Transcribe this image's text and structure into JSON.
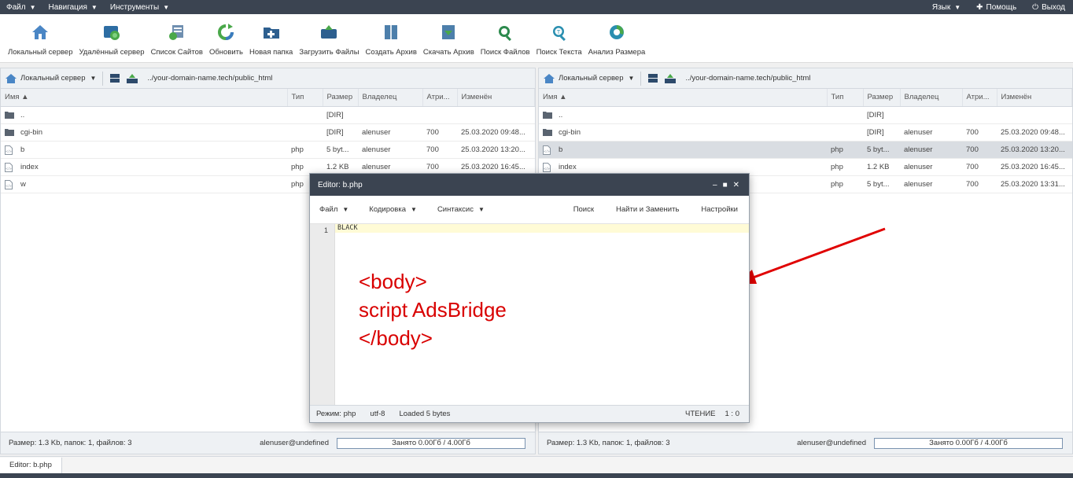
{
  "menu": {
    "file": "Файл",
    "navigation": "Навигация",
    "tools": "Инструменты",
    "language": "Язык",
    "help": "Помощь",
    "logout": "Выход"
  },
  "toolbar": [
    {
      "label": "Локальный сервер",
      "icon": "local-server-icon"
    },
    {
      "label": "Удалённый сервер",
      "icon": "remote-server-icon"
    },
    {
      "label": "Список Сайтов",
      "icon": "site-list-icon"
    },
    {
      "label": "Обновить",
      "icon": "refresh-icon"
    },
    {
      "label": "Новая папка",
      "icon": "new-folder-icon"
    },
    {
      "label": "Загрузить Файлы",
      "icon": "upload-icon"
    },
    {
      "label": "Создать Архив",
      "icon": "archive-icon"
    },
    {
      "label": "Скачать Архив",
      "icon": "download-archive-icon"
    },
    {
      "label": "Поиск Файлов",
      "icon": "search-files-icon"
    },
    {
      "label": "Поиск Текста",
      "icon": "search-text-icon"
    },
    {
      "label": "Анализ Размера",
      "icon": "size-analysis-icon"
    }
  ],
  "columns": {
    "name": "Имя",
    "type": "Тип",
    "size": "Размер",
    "owner": "Владелец",
    "attr": "Атри...",
    "modified": "Изменён"
  },
  "left": {
    "server": "Локальный сервер",
    "path": "../your-domain-name.tech/public_html",
    "rows": [
      {
        "name": "..",
        "type": "",
        "size": "[DIR]",
        "owner": "",
        "attr": "",
        "modified": "",
        "kind": "folder"
      },
      {
        "name": "cgi-bin",
        "type": "",
        "size": "[DIR]",
        "owner": "alenuser",
        "attr": "700",
        "modified": "25.03.2020 09:48...",
        "kind": "folder"
      },
      {
        "name": "b",
        "type": "php",
        "size": "5 byt...",
        "owner": "alenuser",
        "attr": "700",
        "modified": "25.03.2020 13:20...",
        "kind": "file"
      },
      {
        "name": "index",
        "type": "php",
        "size": "1.2 KB",
        "owner": "alenuser",
        "attr": "700",
        "modified": "25.03.2020 16:45...",
        "kind": "file"
      },
      {
        "name": "w",
        "type": "php",
        "size": "",
        "owner": "",
        "attr": "",
        "modified": "",
        "kind": "file"
      }
    ],
    "status": "Размер: 1.3 Kb, папок: 1, файлов: 3",
    "user": "alenuser@undefined",
    "quota": "Занято 0.00Гб / 4.00Гб"
  },
  "right": {
    "server": "Локальный сервер",
    "path": "../your-domain-name.tech/public_html",
    "rows": [
      {
        "name": "..",
        "type": "",
        "size": "[DIR]",
        "owner": "",
        "attr": "",
        "modified": "",
        "kind": "folder"
      },
      {
        "name": "cgi-bin",
        "type": "",
        "size": "[DIR]",
        "owner": "alenuser",
        "attr": "700",
        "modified": "25.03.2020 09:48...",
        "kind": "folder"
      },
      {
        "name": "b",
        "type": "php",
        "size": "5 byt...",
        "owner": "alenuser",
        "attr": "700",
        "modified": "25.03.2020 13:20...",
        "kind": "file",
        "selected": true
      },
      {
        "name": "index",
        "type": "php",
        "size": "1.2 KB",
        "owner": "alenuser",
        "attr": "700",
        "modified": "25.03.2020 16:45...",
        "kind": "file"
      },
      {
        "name": "",
        "type": "php",
        "size": "5 byt...",
        "owner": "alenuser",
        "attr": "700",
        "modified": "25.03.2020 13:31...",
        "kind": "none"
      }
    ],
    "status": "Размер: 1.3 Kb, папок: 1, файлов: 3",
    "user": "alenuser@undefined",
    "quota": "Занято 0.00Гб / 4.00Гб"
  },
  "editor": {
    "title": "Editor: b.php",
    "menu_file": "Файл",
    "menu_encoding": "Кодировка",
    "menu_syntax": "Синтаксис",
    "search": "Поиск",
    "find_replace": "Найти и Заменить",
    "settings": "Настройки",
    "line_number": "1",
    "code_line": "BLACK",
    "mode": "Режим: php",
    "encoding": "utf-8",
    "loaded": "Loaded 5 bytes",
    "readmode": "ЧТЕНИЕ",
    "cursor": "1 : 0"
  },
  "annotation": {
    "line1": "<body>",
    "line2": "script AdsBridge",
    "line3": "</body>",
    "color": "#d90000"
  },
  "taskbar": {
    "task1": "Editor: b.php"
  }
}
